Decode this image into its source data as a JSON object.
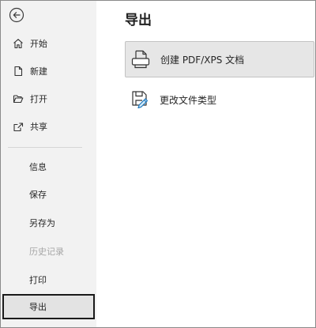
{
  "sidebar": {
    "back_icon": "back-arrow-icon",
    "items": [
      {
        "label": "开始",
        "icon": "home-icon"
      },
      {
        "label": "新建",
        "icon": "new-document-icon"
      },
      {
        "label": "打开",
        "icon": "open-folder-icon"
      },
      {
        "label": "共享",
        "icon": "share-icon"
      },
      {
        "label": "信息"
      },
      {
        "label": "保存"
      },
      {
        "label": "另存为"
      },
      {
        "label": "历史记录",
        "disabled": true
      },
      {
        "label": "打印"
      },
      {
        "label": "导出",
        "selected": true
      }
    ]
  },
  "main": {
    "title": "导出",
    "options": [
      {
        "label": "创建 PDF/XPS 文档",
        "icon": "pdf-xps-document-icon",
        "active": true
      },
      {
        "label": "更改文件类型",
        "icon": "change-file-type-icon"
      }
    ]
  },
  "colors": {
    "sidebar_bg": "#f2f2f2",
    "selected_border": "#1a1a1a",
    "active_option_bg": "#e6e6e6",
    "disabled_text": "#a6a6a6"
  }
}
